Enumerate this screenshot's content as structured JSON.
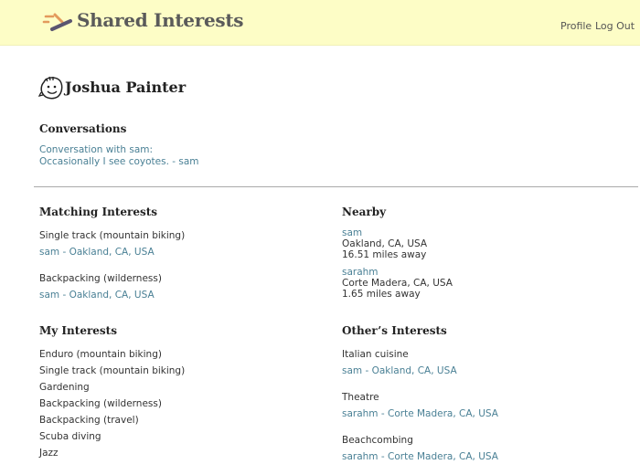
{
  "header": {
    "brand": "Shared Interests",
    "nav": {
      "profile": "Profile",
      "logout": "Log Out"
    },
    "colors": {
      "background": "#fdfdc6",
      "logo_orange": "#e39a5c",
      "logo_dark": "#5a5570"
    }
  },
  "user": {
    "name": "Joshua Painter",
    "avatar_icon": "doodle-face-icon"
  },
  "conversations": {
    "title": "Conversations",
    "items": [
      {
        "subject": "Conversation with sam:",
        "preview": "Occasionally I see coyotes. - sam"
      }
    ]
  },
  "matching_interests": {
    "title": "Matching Interests",
    "items": [
      {
        "interest": "Single track (mountain biking)",
        "user": "sam - Oakland, CA, USA"
      },
      {
        "interest": "Backpacking (wilderness)",
        "user": "sam - Oakland, CA, USA"
      }
    ]
  },
  "nearby": {
    "title": "Nearby",
    "items": [
      {
        "user": "sam",
        "location": "Oakland, CA, USA",
        "distance": "16.51 miles away"
      },
      {
        "user": "sarahm",
        "location": "Corte Madera, CA, USA",
        "distance": "1.65 miles away"
      }
    ]
  },
  "my_interests": {
    "title": "My Interests",
    "items": [
      "Enduro (mountain biking)",
      "Single track (mountain biking)",
      "Gardening",
      "Backpacking (wilderness)",
      "Backpacking (travel)",
      "Scuba diving",
      "Jazz"
    ]
  },
  "others_interests": {
    "title": "Other’s Interests",
    "items": [
      {
        "interest": "Italian cuisine",
        "user": "sam - Oakland, CA, USA"
      },
      {
        "interest": "Theatre",
        "user": "sarahm - Corte Madera, CA, USA"
      },
      {
        "interest": "Beachcombing",
        "user": "sarahm - Corte Madera, CA, USA"
      }
    ]
  },
  "link_color": "#4a8095"
}
